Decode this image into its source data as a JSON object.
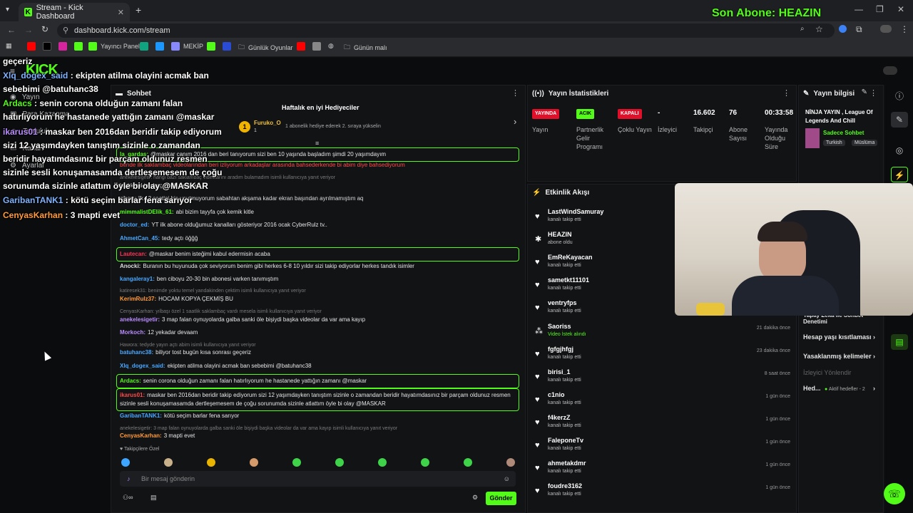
{
  "browser": {
    "tab_title": "Stream - Kick Dashboard",
    "url": "dashboard.kick.com/stream",
    "bookmarks": [
      "Yayıncı Paneli",
      "MEKİP",
      "Günlük Oyunlar",
      "Günün malı"
    ]
  },
  "overlay": {
    "last_sub": "Son Abone: HEAZIN",
    "chat": [
      {
        "name": "",
        "text": "geçeriz"
      },
      {
        "name": "Xlq_dogex_said",
        "text": " : ekipten atilma olayini acmak ban"
      },
      {
        "name": "",
        "text": "sebebimi @batuhanc38"
      },
      {
        "name": "Ardacs",
        "text": " : senin corona olduğun zamanı falan"
      },
      {
        "name": "",
        "text": "hatırlıyorum he hastanede yattığın zamanı @maskar"
      },
      {
        "name": "ikarus01",
        "text": " : maskar ben 2016dan beridir takip ediyorum"
      },
      {
        "name": "",
        "text": "sizi 12 yaşımdayken tanıştım sizinle o zamandan"
      },
      {
        "name": "",
        "text": "beridir hayatımdasınız bir parçam oldunuz resmen"
      },
      {
        "name": "",
        "text": "sizinle sesli konuşamasamda dertleşemesem de çoğu"
      },
      {
        "name": "",
        "text": "sorunumda sizinle atlattım öyle bi olay @MASKAR"
      },
      {
        "name": "GaribanTANK1",
        "text": " : kötü seçim barlar fena sarıyor"
      },
      {
        "name": "CenyasKarhan",
        "text": " : 3 mapti evet"
      }
    ]
  },
  "nav": {
    "items": [
      "Yayın",
      "Para Kazanma",
      "Topluluk",
      "Kanal",
      "Ayarlar"
    ]
  },
  "chat_panel": {
    "title": "Sohbet",
    "gifters_title": "Haftalık en iyi Hediyeciler",
    "top_gifter": "Furuko_O",
    "top_gifter_count": "1",
    "gifter_hint": "1 abonelik hediye ederek 2. sıraya yükselin",
    "messages": [
      {
        "u": "la_gardas:",
        "c": "#53fc18",
        "t": "@maskar canım 2016 dan beri tanıyorum sizi ben 10 yaşında başladım şimdi 20 yaşımdayım",
        "box": true
      },
      {
        "u": "",
        "c": "#ff4a4a",
        "t": "bende ilk saklambaç videolarından beri izliyorum arkadaşlar arasında bahsederkende bi abim diye bahsediyorum"
      },
      {
        "u": "",
        "c": "#888",
        "t": "anekelesigetir: hangi bazı saklambaç videolarını aradım bulamadım isimli kullanıcıya yanıt veriyor",
        "dim": true
      },
      {
        "u": "",
        "c": "#ddd",
        "t": "batlık saklambaç vardı mesela"
      },
      {
        "u": "",
        "c": "#ddd",
        "t": "ciboyu ilk 12 saatini hiç unutmuyorum sabahtan akşama kadar ekran başından ayrılmamıştım aq"
      },
      {
        "u": "mimmalistDElik_61:",
        "c": "#53fc18",
        "t": "abi bizim tayyfa çok kemik kitle"
      },
      {
        "u": "doctor_ed:",
        "c": "#4aa8ff",
        "t": "YT ilk abone olduğumuz kanalları gösteriyor 2016 ocak CyberRulz tv.."
      },
      {
        "u": "AhmetCan_45:",
        "c": "#4aa8ff",
        "t": "tedy açtı öğğğ"
      },
      {
        "u": "Lautecan:",
        "c": "#ff3355",
        "t": "@maskar benim isteğimi kabul edermisin acaba",
        "box": true
      },
      {
        "u": "Anocki:",
        "c": "#ddd",
        "t": "Buranın bu huyunuda çok seviyorum benim gibi herkes 6-8 10 yıldır sizi takip ediyorlar herkes tandık isimler"
      },
      {
        "u": "kangaleray1:",
        "c": "#4aa8ff",
        "t": "ben ciboyu 20-30 bin abonesi varken tanımıştım"
      },
      {
        "u": "",
        "c": "#888",
        "t": "katiresek31: benimde yoktu temel yandakinden çektim isimli kullanıcıya yanıt veriyor",
        "dim": true
      },
      {
        "u": "KerimRulz37:",
        "c": "#ff9b3d",
        "t": "HOCAM KOPYA ÇEKMİŞ BU"
      },
      {
        "u": "",
        "c": "#888",
        "t": "CenyasKarhan: yılbaşı özel 1 saatlik saklambaç vardı mesela isimli kullanıcıya yanıt veriyor",
        "dim": true
      },
      {
        "u": "anekelesigetir:",
        "c": "#b98cff",
        "t": "3 map falan oynuyolarda galba sanki öle bişiydi başka videolar da var ama kayıp"
      },
      {
        "u": "Morkoch:",
        "c": "#b98cff",
        "t": "12 yekadar devaam"
      },
      {
        "u": "",
        "c": "#888",
        "t": "Hawora: tedyde yayın açtı abim isimli kullanıcıya yanıt veriyor",
        "dim": true
      },
      {
        "u": "batuhanc38:",
        "c": "#4aa8ff",
        "t": "biliyor tost bugün kısa sonrası geçeriz"
      },
      {
        "u": "Xlq_dogex_said:",
        "c": "#4aa8ff",
        "t": "ekipten atilma olayini acmak ban sebebimi @batuhanc38"
      },
      {
        "u": "Ardacs:",
        "c": "#53fc18",
        "t": "senin corona olduğun zamanı falan hatırlıyorum he hastanede yattığın zamanı @maskar",
        "box": true
      },
      {
        "u": "ikarus01:",
        "c": "#ff4a4a",
        "t": "maskar ben 2016dan beridir takip ediyorum sizi 12 yaşımdayken tanıştım sizinle o zamandan beridir hayatımdasınız bir parçam oldunuz resmen sizinle sesli konuşamasamda dertleşemesem de çoğu sorunumda sizinle atlattım öyle bi olay @MASKAR",
        "box": true,
        "wrap": true
      },
      {
        "u": "GaribanTANK1:",
        "c": "#4aa8ff",
        "t": "kötü seçim barlar fena sarıyor"
      },
      {
        "u": "",
        "c": "#888",
        "t": "anekelesigetir: 3 map falan oynuyolarda galba sanki öle bişiydi başka videolar da var ama kayıp isimli kullanıcıya yanıt veriyor",
        "dim": true
      },
      {
        "u": "CenyasKarhan:",
        "c": "#ff9b3d",
        "t": "3 mapti evet"
      }
    ],
    "emote_label": "Takipçilere Özel",
    "input_placeholder": "Bir mesaj gönderin",
    "send_label": "Gönder"
  },
  "stats_panel": {
    "title": "Yayın İstatistikleri",
    "items": [
      {
        "badge": "YAYINDA",
        "badge_color": "#e0102a",
        "label": "Yayın"
      },
      {
        "badge": "ACIK",
        "badge_color": "#53fc18",
        "label": "Partnerlik Gelir Programı"
      },
      {
        "badge": "KAPALI",
        "badge_color": "#e0102a",
        "label": "Çoklu Yayın"
      },
      {
        "value": "-",
        "label": "İzleyici"
      },
      {
        "value": "16.602",
        "label": "Takipçi"
      },
      {
        "value": "76",
        "label": "Abone Sayısı"
      },
      {
        "value": "00:33:58",
        "label": "Yayında Olduğu Süre"
      }
    ]
  },
  "info_panel": {
    "title": "Yayın bilgisi",
    "stream_title": "NİNJA YAYIN , League Of Legends And Chill",
    "mode": "Sadece Sohbet",
    "tags": [
      "Turkish",
      "Müslüma"
    ],
    "links": [
      "Yapay Zeka ile Sohbet Denetimi",
      "Hesap yaşı kısıtlaması",
      "Yasaklanmış kelimeler"
    ],
    "dim_link": "İzleyici Yönlendir",
    "goals_label": "Hed...",
    "goals_status": "Aktif hedefler - 2"
  },
  "events_panel": {
    "title": "Etkinlik Akışı",
    "events": [
      {
        "icon": "heart",
        "name": "LastWindSamuray",
        "desc": "kanalı takip etti",
        "time": ""
      },
      {
        "icon": "star",
        "name": "HEAZIN",
        "desc": "abone oldu",
        "time": ""
      },
      {
        "icon": "heart",
        "name": "EmReKayacan",
        "desc": "kanalı takip etti",
        "time": ""
      },
      {
        "icon": "heart",
        "name": "sametkt11101",
        "desc": "kanalı takip etti",
        "time": ""
      },
      {
        "icon": "heart",
        "name": "ventryfps",
        "desc": "kanalı takip etti",
        "time": ""
      },
      {
        "icon": "video",
        "name": "Saoriss",
        "desc": "Video İstek alındı",
        "time": "21 dakika önce"
      },
      {
        "icon": "heart",
        "name": "fgfgjhfgj",
        "desc": "kanalı takip etti",
        "time": "23 dakika önce"
      },
      {
        "icon": "heart",
        "name": "birisi_1",
        "desc": "kanalı takip etti",
        "time": "8 saat önce"
      },
      {
        "icon": "heart",
        "name": "c1nio",
        "desc": "kanalı takip etti",
        "time": "1 gün önce"
      },
      {
        "icon": "heart",
        "name": "f4kerzZ",
        "desc": "kanalı takip etti",
        "time": "1 gün önce"
      },
      {
        "icon": "heart",
        "name": "FaleponeTv",
        "desc": "kanalı takip etti",
        "time": "1 gün önce"
      },
      {
        "icon": "heart",
        "name": "ahmetakdmr",
        "desc": "kanalı takip etti",
        "time": "1 gün önce"
      },
      {
        "icon": "heart",
        "name": "foudre3162",
        "desc": "kanalı takip etti",
        "time": "1 gün önce"
      }
    ]
  },
  "colors": {
    "accent": "#53fc18",
    "live": "#e0102a"
  }
}
